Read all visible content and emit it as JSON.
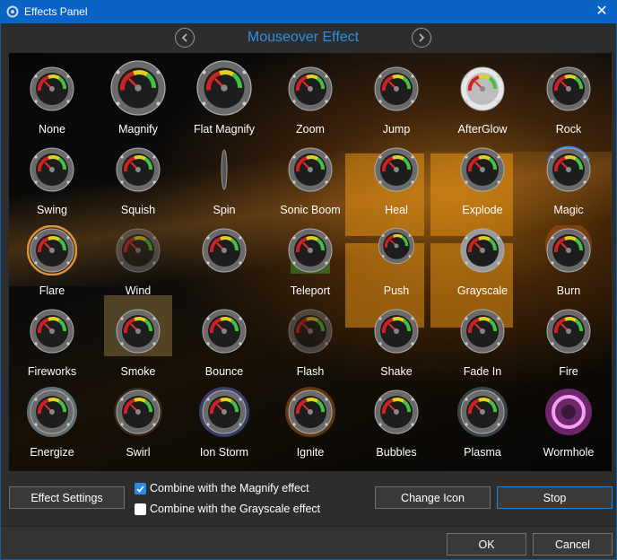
{
  "window": {
    "title": "Effects Panel",
    "close_glyph": "✕",
    "app_icon": "gear-puzzle-icon",
    "accent": "#0a64c8"
  },
  "header": {
    "prev_icon": "chevron-left-icon",
    "next_icon": "chevron-right-icon",
    "title": "Mouseover Effect",
    "title_color": "#2e8fe0"
  },
  "effects": [
    {
      "label": "None",
      "style": "plain"
    },
    {
      "label": "Magnify",
      "style": "big"
    },
    {
      "label": "Flat Magnify",
      "style": "big"
    },
    {
      "label": "Zoom",
      "style": "plain"
    },
    {
      "label": "Jump",
      "style": "plain"
    },
    {
      "label": "AfterGlow",
      "style": "white"
    },
    {
      "label": "Rock",
      "style": "plain"
    },
    {
      "label": "Swing",
      "style": "plain"
    },
    {
      "label": "Squish",
      "style": "plain"
    },
    {
      "label": "Spin",
      "style": "thin"
    },
    {
      "label": "Sonic Boom",
      "style": "plain"
    },
    {
      "label": "Heal",
      "style": "plain"
    },
    {
      "label": "Explode",
      "style": "plain"
    },
    {
      "label": "Magic",
      "style": "bluearc"
    },
    {
      "label": "Flare",
      "style": "ring"
    },
    {
      "label": "Wind",
      "style": "dim"
    },
    {
      "label": "",
      "style": "plain"
    },
    {
      "label": "Teleport",
      "style": "green"
    },
    {
      "label": "Push",
      "style": "small"
    },
    {
      "label": "Grayscale",
      "style": "gray"
    },
    {
      "label": "Burn",
      "style": "burn"
    },
    {
      "label": "Fireworks",
      "style": "plain"
    },
    {
      "label": "Smoke",
      "style": "plain"
    },
    {
      "label": "Bounce",
      "style": "bounce"
    },
    {
      "label": "Flash",
      "style": "dim"
    },
    {
      "label": "Shake",
      "style": "plain"
    },
    {
      "label": "Fade In",
      "style": "plain"
    },
    {
      "label": "Fire",
      "style": "plain"
    },
    {
      "label": "Energize",
      "style": "energy"
    },
    {
      "label": "Swirl",
      "style": "swirl"
    },
    {
      "label": "Ion Storm",
      "style": "ion"
    },
    {
      "label": "Ignite",
      "style": "ignite"
    },
    {
      "label": "Bubbles",
      "style": "bubbles"
    },
    {
      "label": "Plasma",
      "style": "plasma"
    },
    {
      "label": "Wormhole",
      "style": "wormhole"
    }
  ],
  "buttons": {
    "effect_settings": "Effect Settings",
    "change_icon": "Change Icon",
    "stop": "Stop",
    "ok": "OK",
    "cancel": "Cancel"
  },
  "options": {
    "combine_magnify": {
      "label": "Combine with the Magnify effect",
      "checked": true
    },
    "combine_grayscale": {
      "label": "Combine with the Grayscale effect",
      "checked": false
    }
  }
}
